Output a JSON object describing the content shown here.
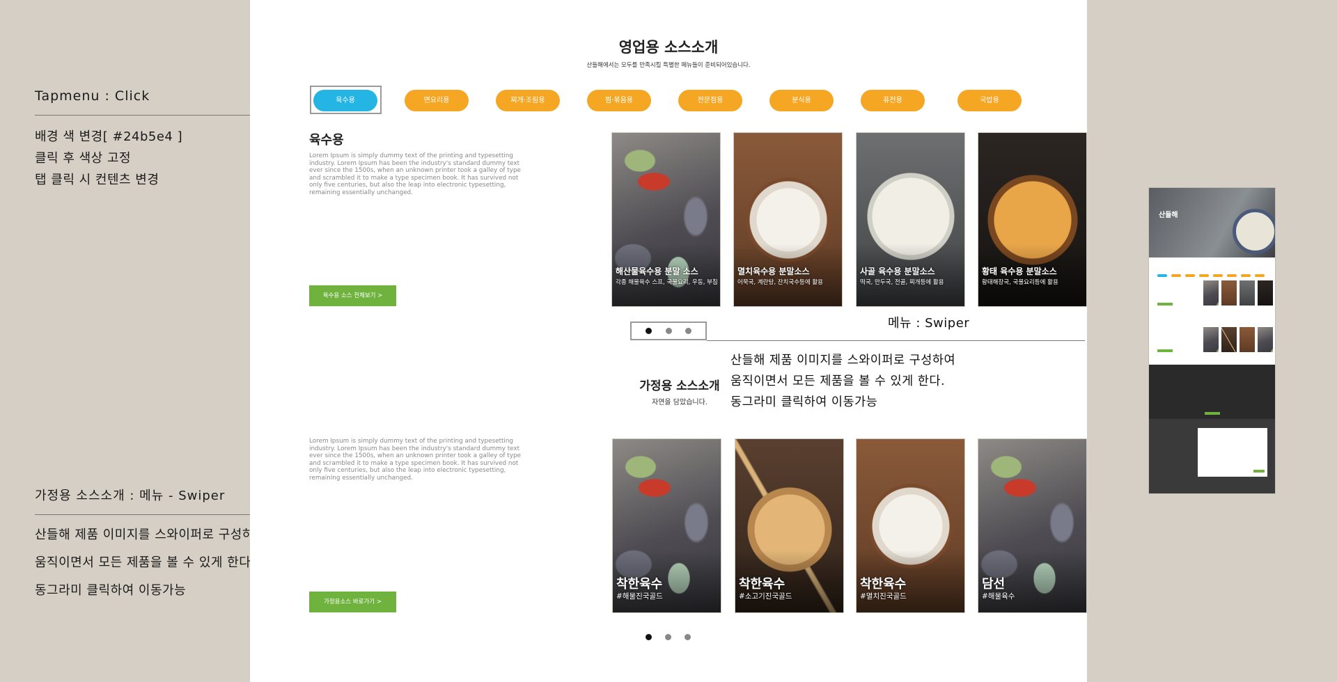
{
  "annotations": {
    "tab": {
      "title": "Tapmenu : Click",
      "lines": [
        "배경 색 변경[ #24b5e4 ]",
        "클릭 후 색상 고정",
        "탭 클릭 시 컨텐츠 변경"
      ]
    },
    "home": {
      "title": "가정용 소스소개 : 메뉴 - Swiper",
      "lines": [
        "산들해 제품 이미지를 스와이퍼로 구성하여",
        "움직이면서 모든 제품을 볼 수 있게 한다.",
        "동그라미 클릭하여 이동가능"
      ]
    },
    "swiper": {
      "label": "메뉴 : Swiper",
      "lines": [
        "산들해 제품 이미지를 스와이퍼로 구성하여",
        "움직이면서 모든 제품을 볼 수 있게 한다.",
        "동그라미 클릭하여 이동가능"
      ]
    }
  },
  "business": {
    "title": "영업용 소스소개",
    "subtitle": "산들해에서는 모두를 만족시킬 특별한 메뉴들이 준비되어있습니다.",
    "tabs": [
      "육수용",
      "면요리용",
      "찌개·조림용",
      "찜·볶음용",
      "전문점용",
      "분식용",
      "퓨전용",
      "국밥용"
    ],
    "active_tab": "육수용",
    "category_title": "육수용",
    "lorem": "Lorem Ipsum is simply dummy text of the printing and typesetting industry. Lorem Ipsum has been the industry's standard dummy text ever since the 1500s, when an unknown printer took a galley of type and scrambled it to make a type specimen book. It has survived not only five centuries, but also the leap into electronic typesetting, remaining essentially unchanged.",
    "button": "육수용 소스 전체보기 >",
    "cards": [
      {
        "title": "해산물육수용 분말 소스",
        "desc": "각종 해물육수 스프, 국물요리, 우동, 부침",
        "image": "clam"
      },
      {
        "title": "멸치육수용 분말소스",
        "desc": "어묵국, 계란탕, 잔치국수등에 활용",
        "image": "noodle"
      },
      {
        "title": "사골 육수용 분말소스",
        "desc": "떡국, 만두국, 전골, 찌개등에 활용",
        "image": "dumpling"
      },
      {
        "title": "황태 육수용 분말소스",
        "desc": "황태해장국, 국물요리등에 활용",
        "image": "stew"
      }
    ]
  },
  "home": {
    "title": "가정용 소스소개",
    "subtitle": "자연을 담았습니다.",
    "lorem": "Lorem Ipsum is simply dummy text of the printing and typesetting industry. Lorem Ipsum has been the industry's standard dummy text ever since the 1500s, when an unknown printer took a galley of type and scrambled it to make a type specimen book. It has survived not only five centuries, but also the leap into electronic typesetting, remaining essentially unchanged.",
    "button": "가정용소스 바로가기 >",
    "cards": [
      {
        "title": "착한육수",
        "tag": "#해물진국골드",
        "image": "clam"
      },
      {
        "title": "착한육수",
        "tag": "#소고기진국골드",
        "image": "fishcake"
      },
      {
        "title": "착한육수",
        "tag": "#멸치진국골드",
        "image": "noodle"
      },
      {
        "title": "담선",
        "tag": "#해물육수",
        "image": "clam"
      }
    ]
  },
  "thumbnail": {
    "logo": "산들해",
    "colors": {
      "tab_active": "#24b5e4",
      "tab": "#f5a623",
      "button": "#6fb33e"
    }
  }
}
